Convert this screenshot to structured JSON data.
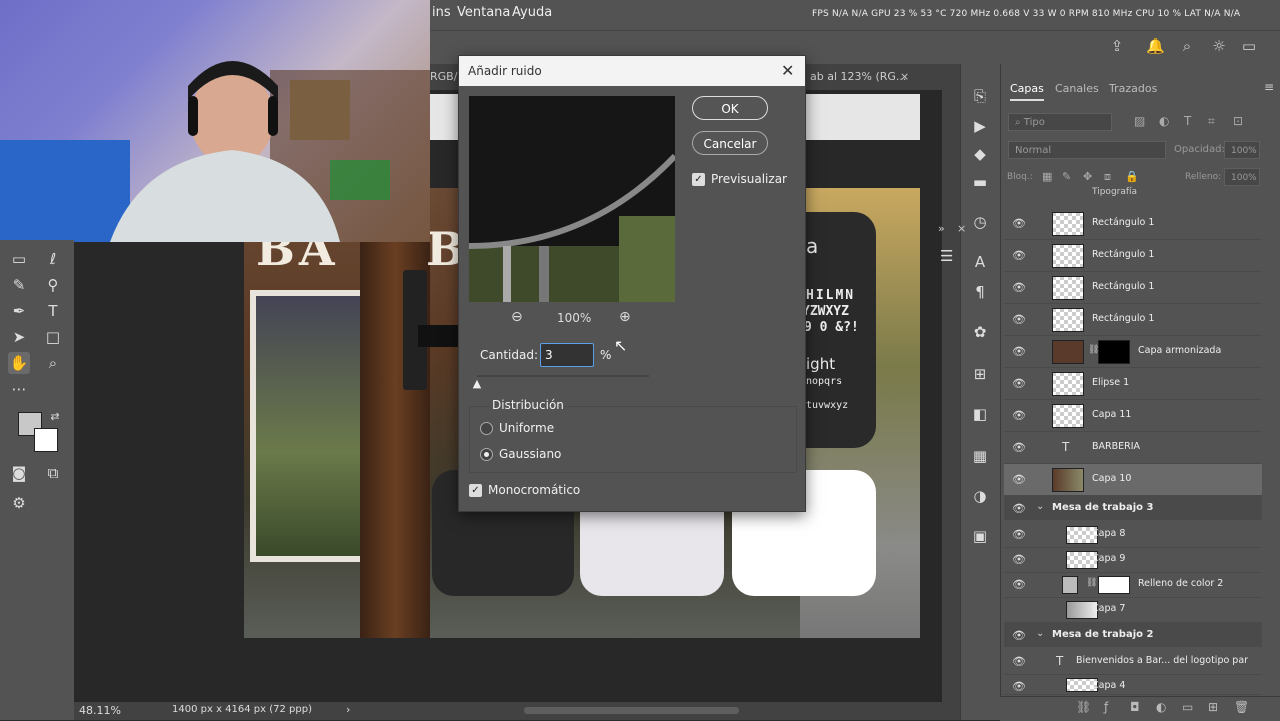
{
  "menubar": {
    "items": [
      "ins",
      "Ventana",
      "Ayuda"
    ],
    "status": "FPS  N/A  N/A    GPU  23 %  53 °C  720 MHz  0.668 V  33 W  0 RPM  810 MHz    CPU  10 %    LAT  N/A  N/A"
  },
  "tabs": {
    "doc1": "RGB/",
    "doc2": "ab al 123% (RG...",
    "doc2_close": "×"
  },
  "artwork": {
    "title_left": "BA",
    "title_right": "B",
    "card_letter": "a",
    "card_line1": "HILMN",
    "card_line2": "YZWXYZ",
    "card_line3": "9 0 &?!",
    "card_line4": "ight",
    "card_line5": "nopqrs",
    "card_line6": "tuvwxyz"
  },
  "dialog": {
    "title": "Añadir ruido",
    "ok_label": "OK",
    "cancel_label": "Cancelar",
    "preview_label": "Previsualizar",
    "preview_checked": true,
    "zoom_level": "100%",
    "amount_label": "Cantidad:",
    "amount_value": "3",
    "amount_unit": "%",
    "amount_fraction": 0.01,
    "distribution_label": "Distribución",
    "uniform_label": "Uniforme",
    "gaussian_label": "Gaussiano",
    "selected_distribution": "Gaussiano",
    "mono_label": "Monocromático",
    "mono_checked": true
  },
  "bottom": {
    "zoom": "48.11%",
    "doc_size": "1400 px x 4164 px (72 ppp)",
    "arrow": "›"
  },
  "layers_panel": {
    "tabs": [
      "Capas",
      "Canales",
      "Trazados"
    ],
    "search_placeholder": "Tipo",
    "blend_mode": "Normal",
    "opacity_label": "Opacidad:",
    "opacity_value": "100%",
    "lock_label": "Bloq.:",
    "fill_label": "Relleno:",
    "fill_value": "100%",
    "partial_top": "Tipografía",
    "layers": [
      "Rectángulo 1",
      "Rectángulo 1",
      "Rectángulo 1",
      "Rectángulo 1",
      "Capa armonizada",
      "Elipse 1",
      "Capa 11",
      "BARBERIA",
      "Capa 10"
    ],
    "group3": "Mesa de trabajo 3",
    "group3_layers": [
      "Capa 8",
      "Capa 9",
      "Relleno de color 2",
      "Capa 7"
    ],
    "group2": "Mesa de trabajo 2",
    "group2_layers": [
      "Bienvenidos a Bar... del logotipo par",
      "Capa 4"
    ]
  },
  "colors": {
    "accent": "#5aa0e8",
    "panel": "#535353",
    "dark": "#282828"
  }
}
